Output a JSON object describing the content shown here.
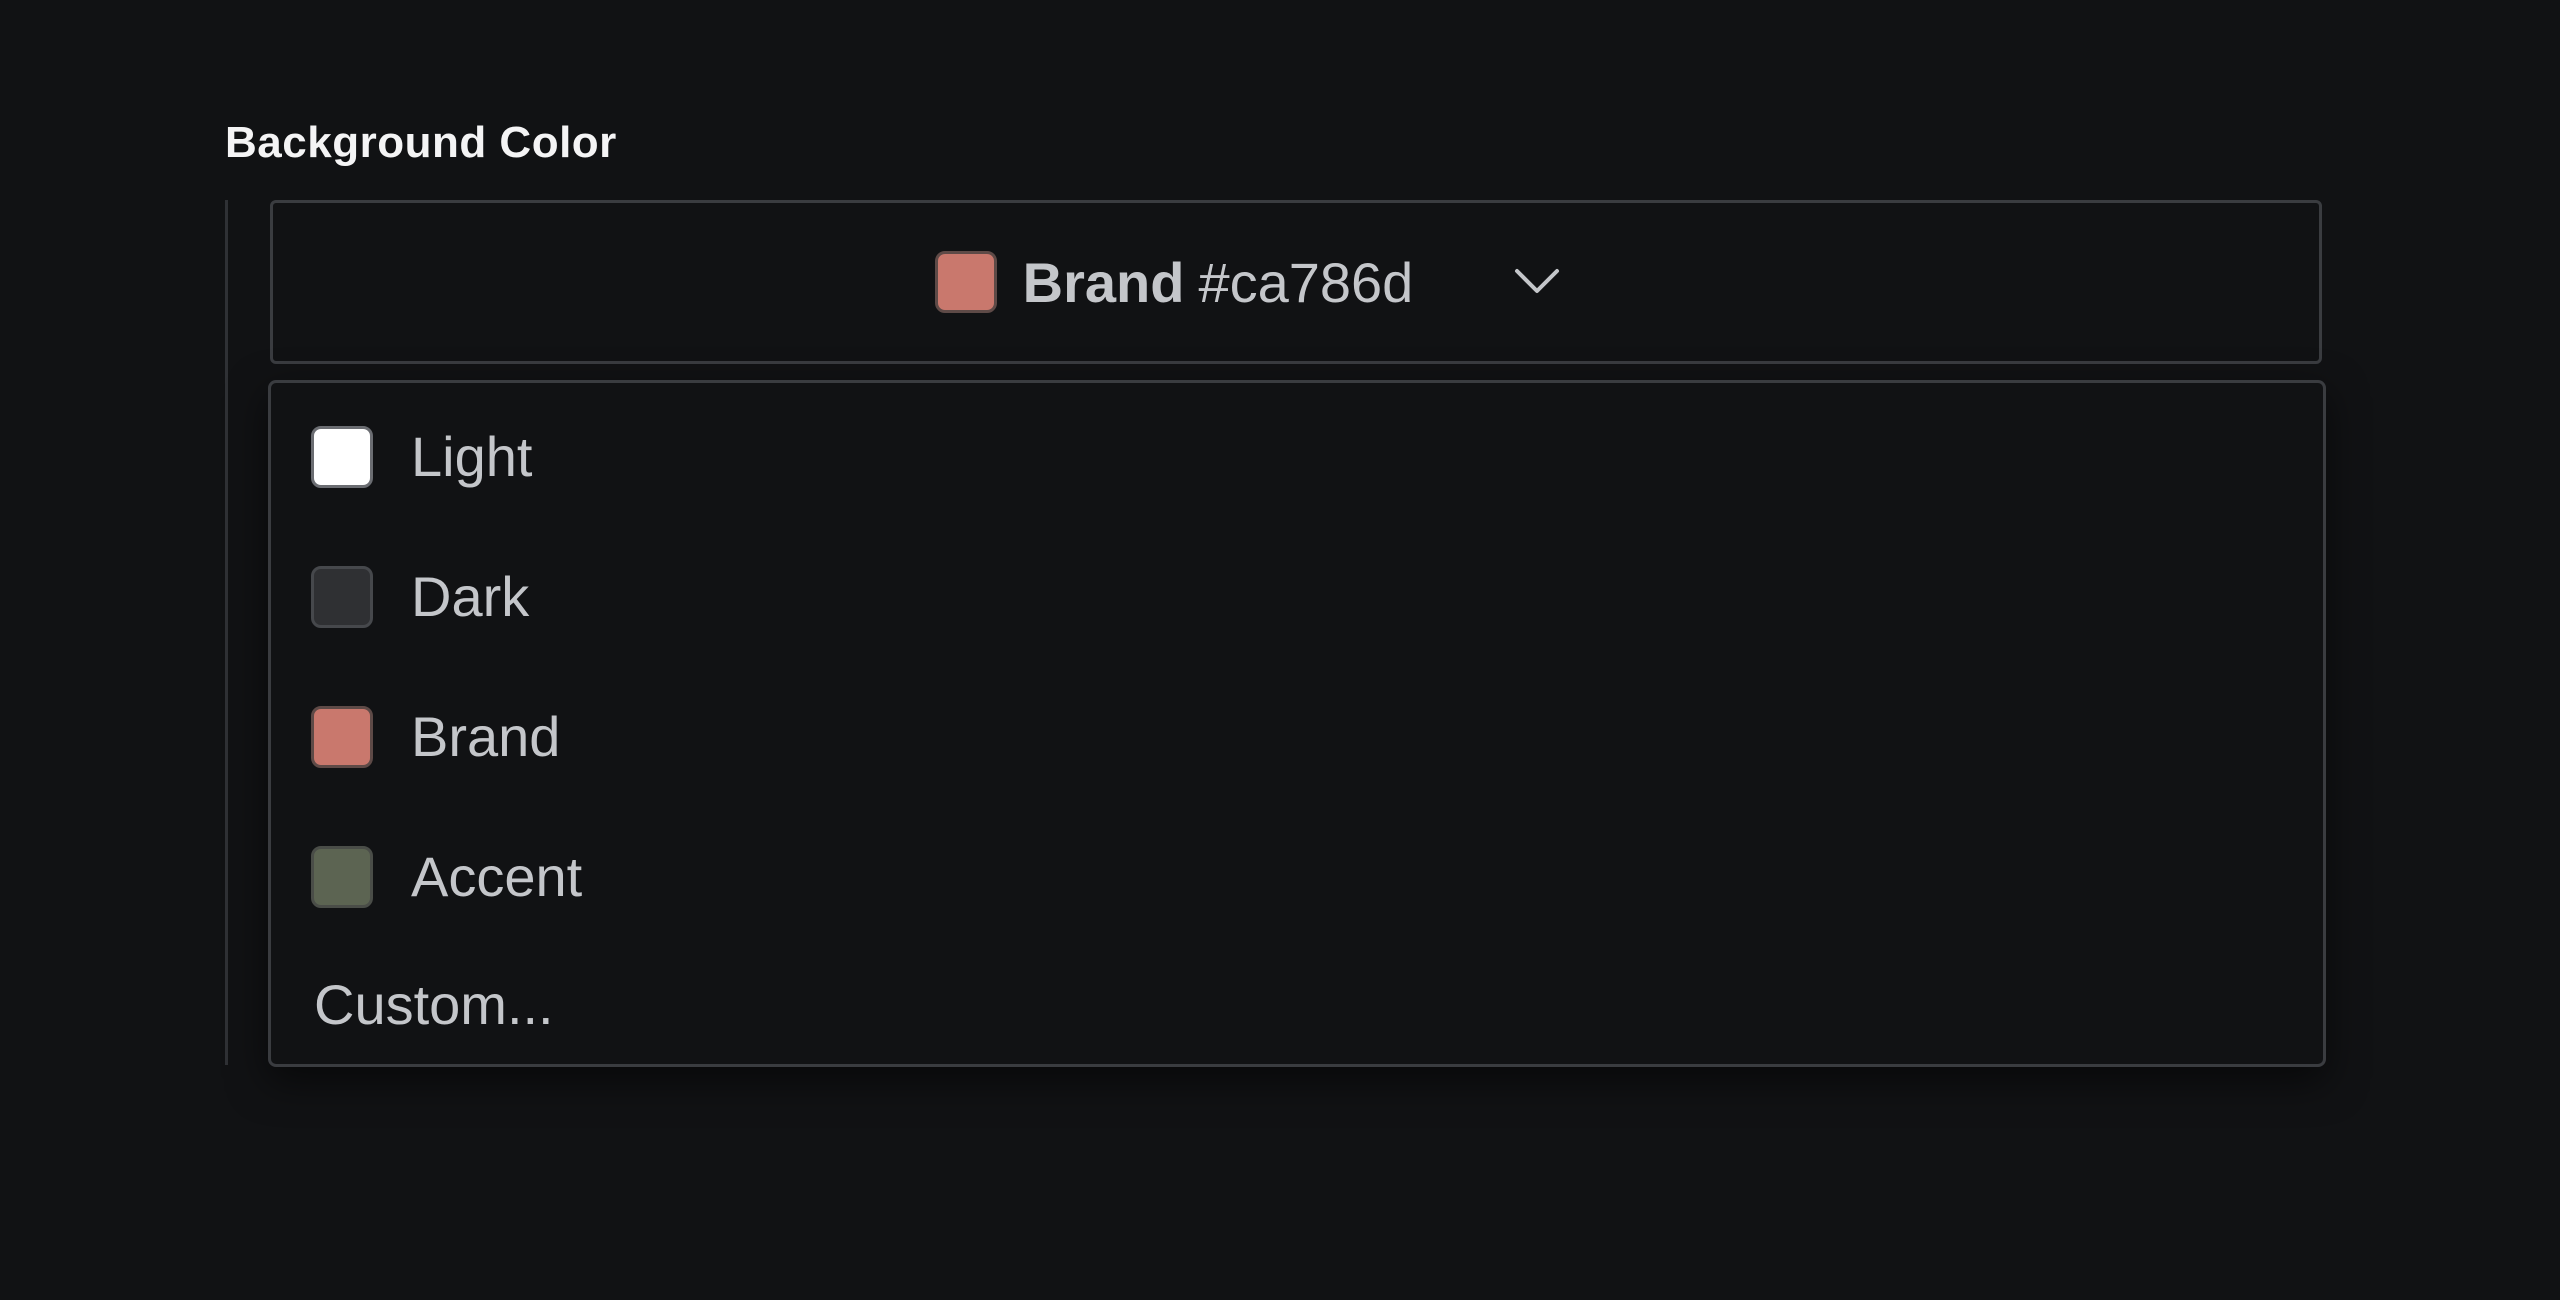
{
  "field": {
    "label": "Background Color"
  },
  "select": {
    "selected_name": "Brand",
    "selected_hex": "#ca786d",
    "selected_color": "#c9786d",
    "chevron_icon": "chevron-down-icon"
  },
  "options": [
    {
      "label": "Light",
      "color": "#ffffff",
      "border": "#6b6d72"
    },
    {
      "label": "Dark",
      "color": "#2f3033",
      "border": "#46484c"
    },
    {
      "label": "Brand",
      "color": "#c9786d",
      "border": "#5e4a47"
    },
    {
      "label": "Accent",
      "color": "#5c6452",
      "border": "#4a4d48"
    }
  ],
  "custom_option": {
    "label": "Custom..."
  }
}
